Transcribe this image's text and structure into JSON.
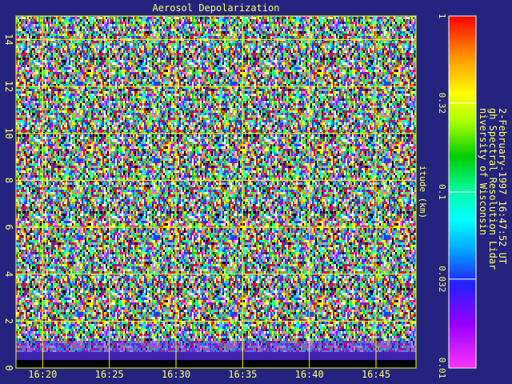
{
  "chart_data": {
    "type": "heatmap",
    "title": "Aerosol Depolarization",
    "ylabel": "itude (km)",
    "ylim": [
      0,
      15
    ],
    "y_ticks": [
      "0",
      "2",
      "4",
      "6",
      "8",
      "10",
      "12",
      "14"
    ],
    "xlim": [
      "16:18",
      "16:48"
    ],
    "x_ticks": [
      "16:20",
      "16:25",
      "16:30",
      "16:35",
      "16:40",
      "16:45"
    ],
    "grid": true,
    "colorbar": {
      "scale": "log",
      "range": [
        0.01,
        1
      ],
      "ticks": [
        "0.01",
        "0.032",
        "0.1",
        "0.32",
        "1"
      ]
    },
    "credits": [
      "niversity of Wisconsin",
      "gh Spectral Resolution Lidar",
      "2-February-1997 16:47:52 UT"
    ],
    "colors": {
      "background": "#24247e",
      "text": "#ffff66",
      "grid": "#ffff00"
    }
  }
}
